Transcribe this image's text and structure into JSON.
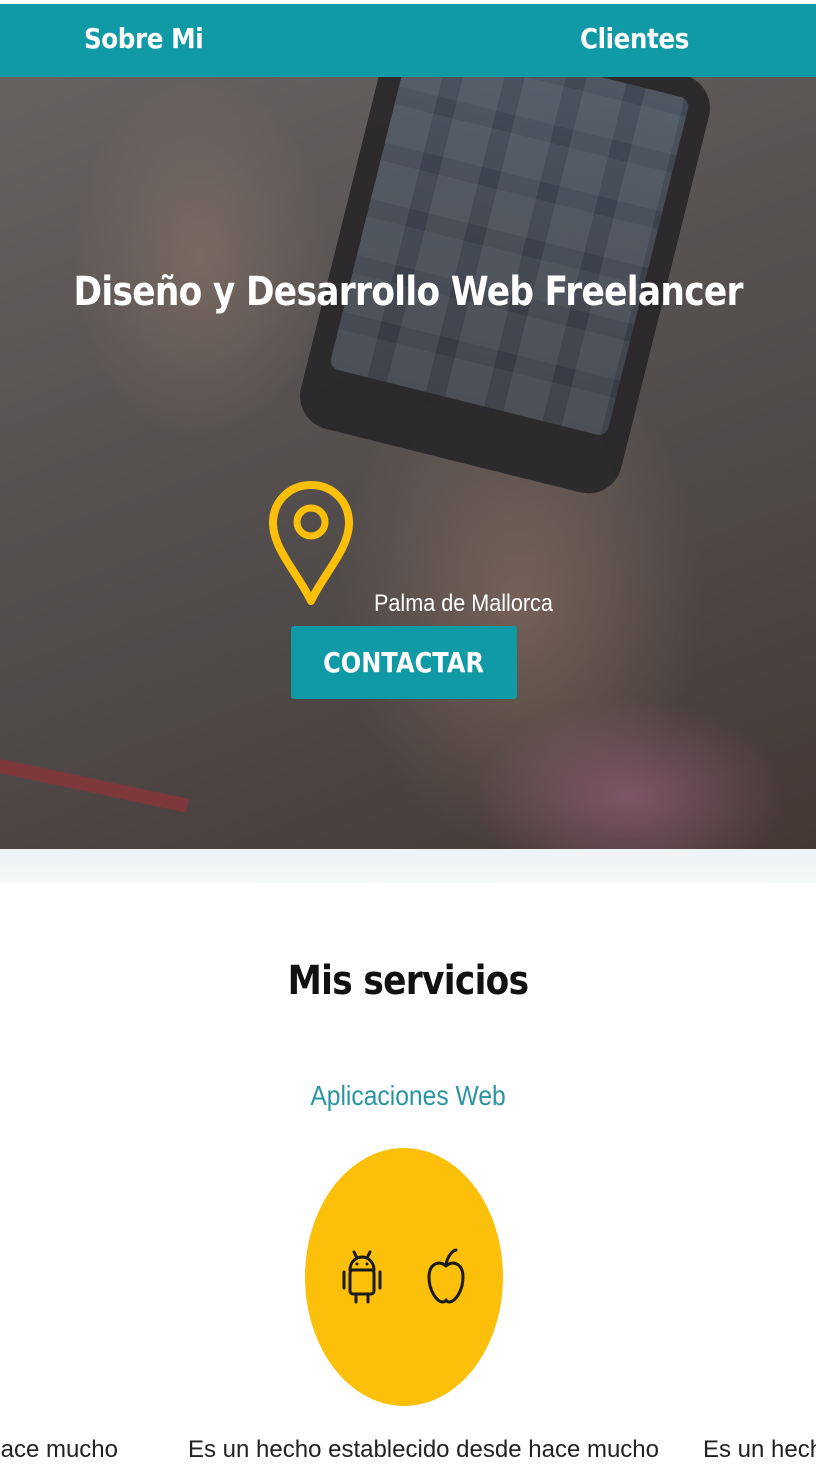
{
  "nav": {
    "items": [
      {
        "label": "Sobre Mi"
      },
      {
        "label": "Clientes"
      }
    ]
  },
  "hero": {
    "title": "Diseño y Desarrollo Web Freelancer",
    "location": "Palma de Mallorca",
    "cta_label": "CONTACTAR",
    "location_icon": "map-pin-icon"
  },
  "services": {
    "title": "Mis servicios",
    "items": [
      {
        "name": "Aplicaciones Web",
        "icons": [
          "android-icon",
          "apple-icon"
        ],
        "description_visible_left": "hace mucho",
        "description_visible_center": "Es un hecho establecido desde hace mucho",
        "description_visible_right": "Es un hecho"
      }
    ]
  },
  "colors": {
    "brand_teal": "#109aa6",
    "accent_yellow": "#fcbf0a",
    "service_name_teal": "#2a95a2"
  }
}
